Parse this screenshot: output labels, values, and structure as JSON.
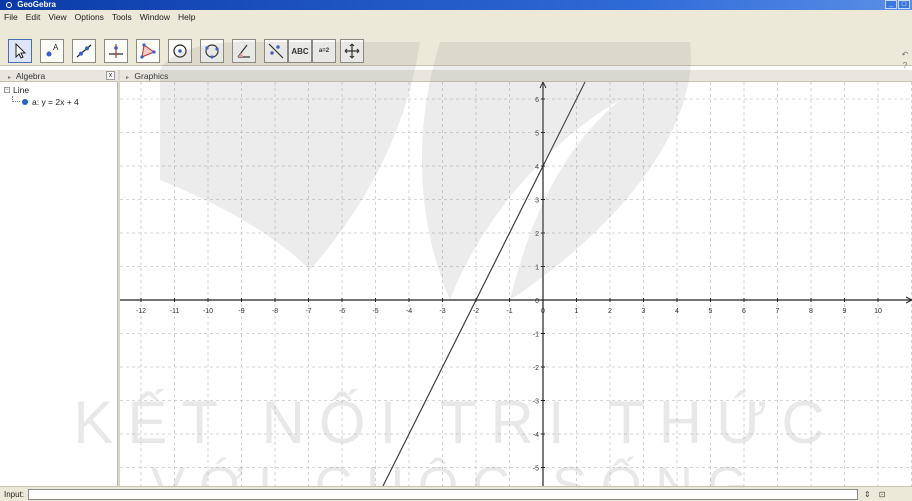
{
  "window": {
    "title": "GeoGebra",
    "controls": [
      "_",
      "□"
    ]
  },
  "menu": [
    "File",
    "Edit",
    "View",
    "Options",
    "Tools",
    "Window",
    "Help"
  ],
  "toolbar": {
    "tools": [
      {
        "name": "move-tool",
        "icon": "arrow-cursor-icon"
      },
      {
        "name": "new-point-tool",
        "icon": "point-icon"
      },
      {
        "name": "line-tool",
        "icon": "line-through-two-points-icon"
      },
      {
        "name": "perpendicular-line-tool",
        "icon": "perpendicular-line-icon"
      },
      {
        "name": "polygon-tool",
        "icon": "polygon-icon"
      },
      {
        "name": "circle-tool",
        "icon": "circle-center-point-icon"
      },
      {
        "name": "conic-tool",
        "icon": "circle-three-points-icon"
      },
      {
        "name": "angle-tool",
        "icon": "angle-icon"
      },
      {
        "name": "reflect-tool",
        "icon": "reflect-line-icon"
      },
      {
        "name": "text-tool",
        "icon": "text-icon",
        "label": "ABC"
      },
      {
        "name": "slider-tool",
        "icon": "slider-icon",
        "label": "a=2"
      },
      {
        "name": "move-graphics-tool",
        "icon": "move-graphics-icon"
      }
    ],
    "right_icons": [
      "undo-icon",
      "help-icon"
    ]
  },
  "algebra": {
    "header": "Algebra",
    "close_label": "x",
    "group_label": "Line",
    "items": [
      {
        "label": "a: y = 2x + 4",
        "color": "#2a5fc4"
      }
    ]
  },
  "graphics": {
    "header": "Graphics",
    "x_ticks": [
      -12,
      -11,
      -10,
      -9,
      -8,
      -7,
      -6,
      -5,
      -4,
      -3,
      -2,
      -1,
      0,
      1,
      2,
      3,
      4,
      5,
      6,
      7,
      8,
      9,
      10
    ],
    "y_ticks": [
      6,
      5,
      4,
      3,
      2,
      1,
      0,
      -1,
      -2,
      -3,
      -4,
      -5
    ],
    "line": {
      "slope": 2,
      "intercept": 4,
      "color": "#333333"
    }
  },
  "watermark": {
    "line1": "KẾT NỐI TRI THỨC",
    "line2": "VỚI CUỘC SỐNG"
  },
  "input": {
    "label": "Input:",
    "value": "",
    "right_icons": [
      "alpha-dropdown-icon",
      "input-help-icon"
    ]
  }
}
